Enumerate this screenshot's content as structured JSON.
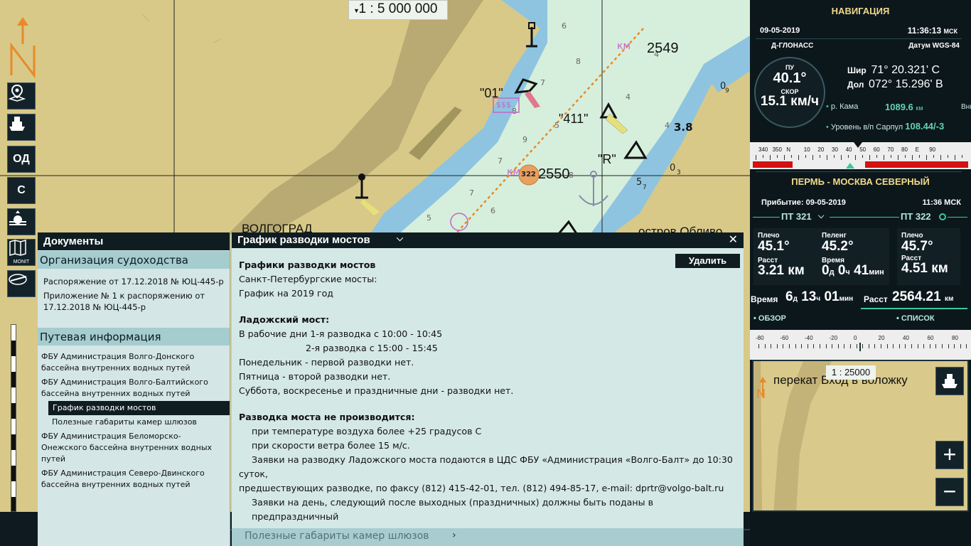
{
  "map": {
    "scale_label": "1 : 5 000 000",
    "labels": {
      "city": "ВОЛГОГРАД",
      "island": "остров Обливо",
      "depth_2549": "2549",
      "depth_2550": "2550",
      "km": "км",
      "buoy_01": "\"01\"",
      "buoy_411": "\"411\"",
      "buoy_R": "\"R\"",
      "vessel_id": "322",
      "depth_38": "3.8",
      "money": "$$$"
    },
    "toolbar": {
      "north_label": "N",
      "od_label": "ОД",
      "c_label": "С",
      "monit_label": "MONIT"
    }
  },
  "docs": {
    "title": "Документы",
    "section1": "Организация судоходства",
    "items1": [
      "Распоряжение от 17.12.2018 № ЮЦ-445-р",
      "Приложение № 1 к распоряжению от 17.12.2018 № ЮЦ-445-р"
    ],
    "section2": "Путевая информация",
    "items2": [
      {
        "label": "ФБУ Администрация Волго-Донского бассейна внутренних водных путей"
      },
      {
        "label": "ФБУ Администрация Волго-Балтийского бассейна внутренних водных путей"
      },
      {
        "label": "График разводки мостов",
        "sub": true,
        "active": true
      },
      {
        "label": "Полезные габариты камер шлюзов",
        "sub": true
      },
      {
        "label": "ФБУ Администрация Беломорско-Онежского бассейна внутренних водных путей"
      },
      {
        "label": "ФБУ Администрация Северо-Двинского бассейна внутренних водных путей"
      }
    ]
  },
  "bridge": {
    "title": "График разводки мостов",
    "delete_label": "Удалить",
    "heading": "Графики разводки мостов",
    "line1": "Санкт-Петербургские мосты:",
    "line2": "График на 2019 год",
    "ladoga_title": "Ладожский мост:",
    "ladoga_lines": [
      "В рабочие дни 1-я разводка с 10:00 - 10:45",
      "2-я разводка с 15:00 - 15:45",
      "Понедельник - первой разводки нет.",
      "Пятница - второй разводки нет.",
      "Суббота, воскресенье и праздничные дни - разводки нет."
    ],
    "no_title": "Разводка моста не производится:",
    "no_lines": [
      "при температуре воздуха более +25 градусов С",
      "при скорости ветра более 15 м/с.",
      "Заявки на разводку Ладожского моста подаются в ЦДС ФБУ «Администрация «Волго-Балт» до 10:30 суток,",
      "предшествующих разводке, по факсу (812) 415-42-01, тел. (812) 494-85-17, e-mail: dprtr@volgo-balt.ru",
      "Заявки на день, следующий после выходных (праздничных) должны быть поданы в предпраздничный"
    ],
    "footer": "Полезные габариты камер шлюзов"
  },
  "nav": {
    "title": "НАВИГАЦИЯ",
    "date": "09-05-2019",
    "time": "11:36:13",
    "time_zone": "МСК",
    "source": "Д-ГЛОНАСС",
    "datum_label": "Датум",
    "datum": "WGS-84",
    "heading_label": "ПУ",
    "heading": "40.1°",
    "speed_label": "СКОР",
    "speed": "15.1 км/ч",
    "lat_label": "Шир",
    "lat": "71° 20.321' С",
    "lon_label": "Дол",
    "lon": "072° 15.296' В",
    "river": "р. Кама",
    "river_km": "1089.6",
    "river_km_unit": "км",
    "direction": "Вниз",
    "level_label": "Уровень в/п Сарпул",
    "level": "108.44/-3",
    "compass_ticks": [
      "340",
      "350",
      "N",
      "10",
      "20",
      "30",
      "40",
      "50",
      "60",
      "70",
      "80",
      "E",
      "90"
    ],
    "route_title": "ПЕРМЬ - МОСКВА СЕВЕРНЫЙ",
    "arrival_label": "Прибытие:",
    "arrival_date": "09-05-2019",
    "arrival_time": "11:36 МСК",
    "pt1": "ПТ 321",
    "pt2": "ПТ 322",
    "pt1_shoulder_label": "Плечо",
    "pt1_shoulder": "45.1°",
    "bearing_label": "Пеленг",
    "bearing": "45.2°",
    "pt1_dist_label": "Расст",
    "pt1_dist": "3.21 км",
    "eta_label": "Время",
    "eta_d": "0",
    "eta_d_unit": "д",
    "eta_h": "0",
    "eta_h_unit": "ч",
    "eta_m": "41",
    "eta_m_unit": "мин",
    "pt2_shoulder_label": "Плечо",
    "pt2_shoulder": "45.7°",
    "pt2_dist_label": "Расст",
    "pt2_dist": "4.51 км",
    "total_time_label": "Время",
    "total_d": "6",
    "total_d_unit": "д",
    "total_h": "13",
    "total_h_unit": "ч",
    "total_m": "01",
    "total_m_unit": "мин",
    "total_dist_label": "Расст",
    "total_dist": "2564.21",
    "total_dist_unit": "км",
    "link_overview": "• ОБЗОР",
    "link_list": "• СПИСОК",
    "deviation_ticks": [
      "-80",
      "-60",
      "-40",
      "-20",
      "0",
      "20",
      "40",
      "60",
      "80"
    ]
  },
  "minimap": {
    "scale": "1 : 25000",
    "label": "перекат Вход в воложку",
    "north": "N",
    "zoom_in": "+",
    "zoom_out": "−"
  }
}
